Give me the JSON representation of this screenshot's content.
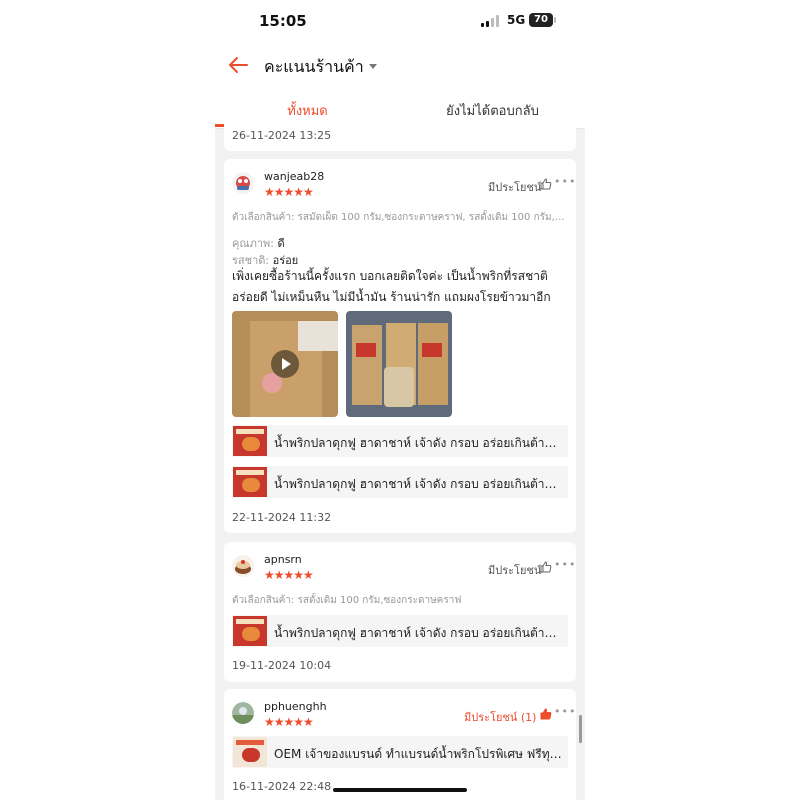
{
  "status_bar": {
    "time": "15:05",
    "network": "5G",
    "battery": "70"
  },
  "header": {
    "title": "คะแนนร้านค้า"
  },
  "tabs": [
    {
      "label": "ทั้งหมด",
      "active": true
    },
    {
      "label": "ยังไม่ได้ตอบกลับ",
      "active": false
    }
  ],
  "reviews": [
    {
      "date": "26-11-2024 13:25"
    },
    {
      "username": "wanjeab28",
      "stars": "★★★★★",
      "useful": "มีประโยชน์",
      "variant": "ตัวเลือกสินค้า: รสมัดเผ็ด 100 กรัม,ซองกระดาษคราฟ, รสดั้งเดิม 100 กรัม,ซ...",
      "quality_label": "คุณภาพ: ",
      "quality_value": "ดี",
      "taste_label": "รสชาติ: ",
      "taste_value": "อร่อย",
      "text": "เพิ่งเคยซื้อร้านนี้ครั้งแรก บอกเลยติดใจค่ะ เป็นน้ำพริกที่รสชาติอร่อยดี ไม่เหม็นหืน ไม่มีน้ำมัน ร้านน่ารัก แถมผงโรยข้าวมาอีก",
      "products": [
        "น้ำพริกปลาดุกฟู ฮาดาชาห์ เจ้าดัง กรอบ อร่อยเกินต้าน รี...",
        "น้ำพริกปลาดุกฟู ฮาดาชาห์ เจ้าดัง กรอบ อร่อยเกินต้าน รี..."
      ],
      "date": "22-11-2024 11:32"
    },
    {
      "username": "apnsrn",
      "stars": "★★★★★",
      "useful": "มีประโยชน์",
      "variant": "ตัวเลือกสินค้า: รสดั้งเดิม 100 กรัม,ซองกระดาษคราฟ",
      "products": [
        "น้ำพริกปลาดุกฟู ฮาดาชาห์ เจ้าดัง กรอบ อร่อยเกินต้าน รี..."
      ],
      "date": "19-11-2024 10:04"
    },
    {
      "username": "pphuenghh",
      "stars": "★★★★★",
      "useful": "มีประโยชน์ (1)",
      "products": [
        "OEM เจ้าของแบรนด์ ทำแบรนด์น้ำพริกโปรพิเศษ ฟรีทุกร..."
      ],
      "date": "16-11-2024 22:48"
    }
  ],
  "colors": {
    "accent": "#ee4d2d",
    "background": "#f2f2f2"
  },
  "icons": [
    "back-arrow-icon",
    "dropdown-caret-icon",
    "thumbs-up-icon",
    "more-icon",
    "play-icon"
  ]
}
